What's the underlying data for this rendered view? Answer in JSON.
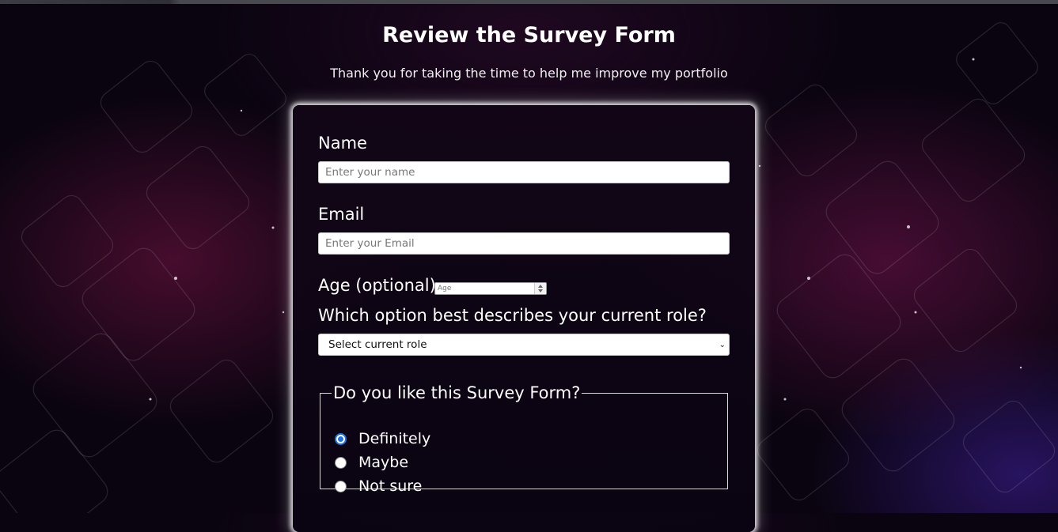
{
  "page": {
    "title": "Review the Survey Form",
    "subtitle": "Thank you for taking the time to help me improve my portfolio"
  },
  "form": {
    "name": {
      "label": "Name",
      "placeholder": "Enter your name",
      "value": ""
    },
    "email": {
      "label": "Email",
      "placeholder": "Enter your Email",
      "value": ""
    },
    "age": {
      "label": "Age (optional)",
      "placeholder": "Age",
      "value": ""
    },
    "role": {
      "label": "Which option best describes your current role?",
      "selected": "Select current role"
    },
    "like": {
      "legend": "Do you like this Survey Form?",
      "options": [
        {
          "label": "Definitely",
          "checked": true
        },
        {
          "label": "Maybe",
          "checked": false
        },
        {
          "label": "Not sure",
          "checked": false
        }
      ]
    }
  },
  "colors": {
    "accent": "#1a73e8",
    "background": "#0a0410",
    "card_glow": "#ffffff"
  },
  "icons": {
    "select_chevron": "chevron-down-icon",
    "age_spinner": "spinner-icon"
  }
}
